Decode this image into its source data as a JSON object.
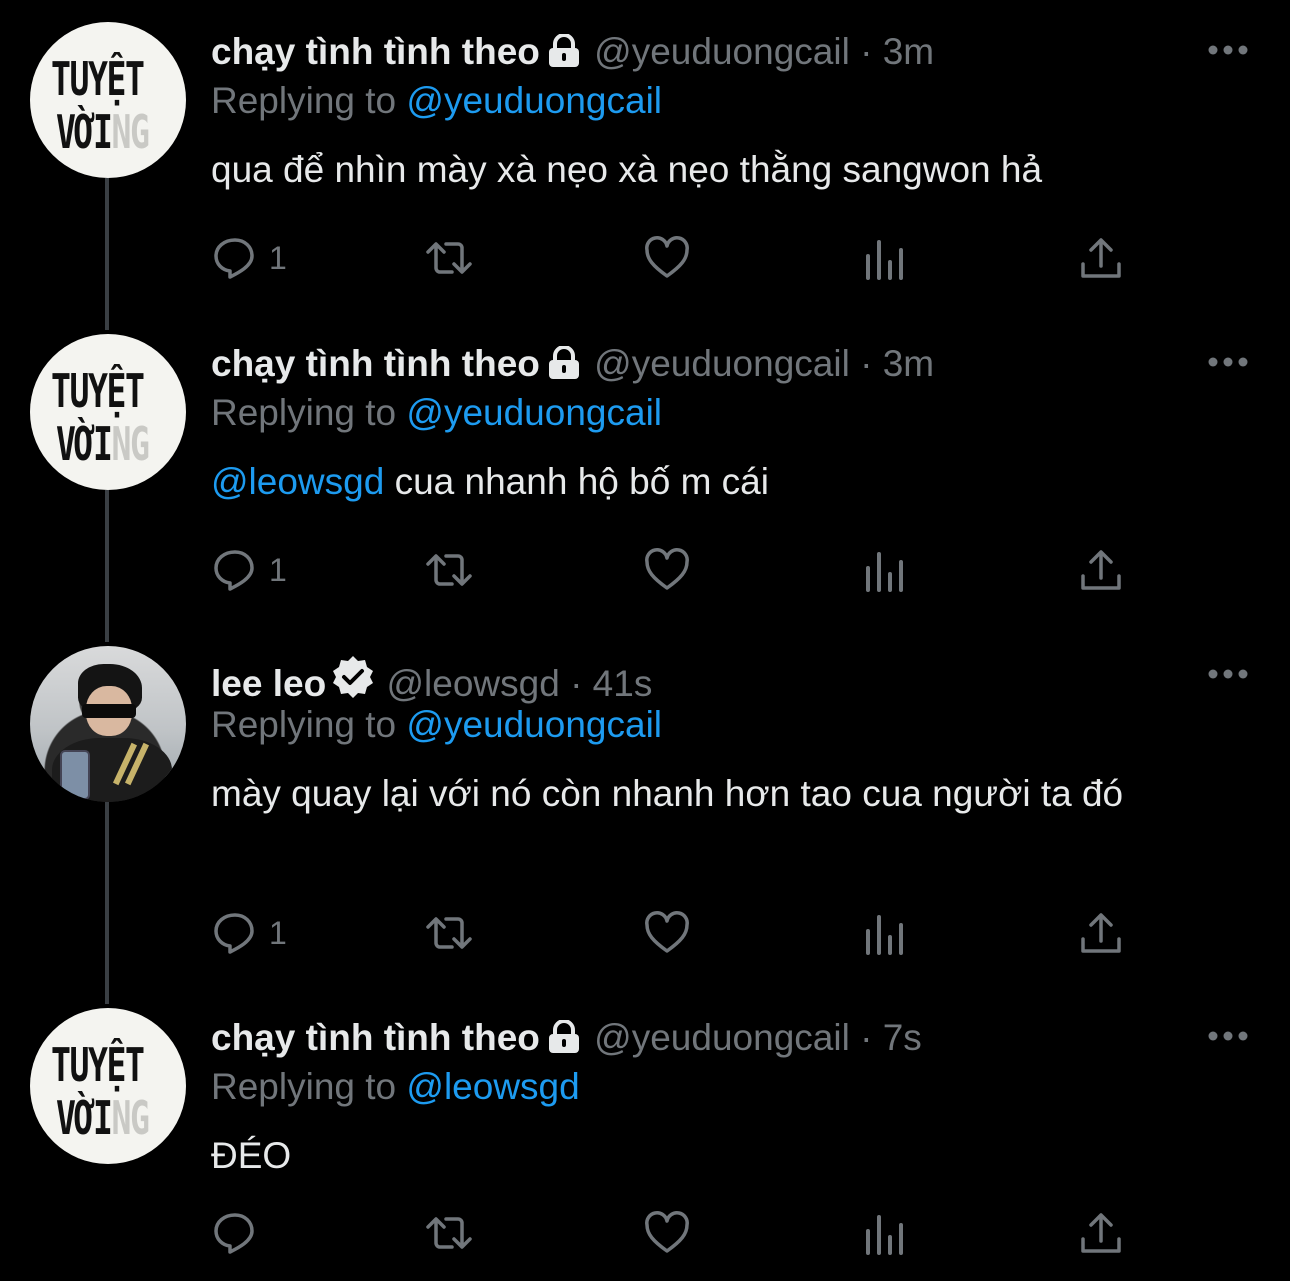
{
  "colors": {
    "background": "#000000",
    "text": "#e7e9ea",
    "muted": "#71767b",
    "link": "#1d9bf0",
    "thread_line": "#3a3f44"
  },
  "tweets": [
    {
      "avatar_logo": [
        "TUYỆT",
        "VỜI",
        "NG"
      ],
      "name": "chạy tình tình theo",
      "badge_icon": "lock-icon",
      "handle": "@yeuduongcail",
      "dot": "·",
      "time": "3m",
      "replying_prefix": "Replying to",
      "replying_to": "@yeuduongcail",
      "mention": "",
      "text": "qua để nhìn mày xà nẹo xà nẹo thằng sangwon hả",
      "reply_count": "1"
    },
    {
      "avatar_logo": [
        "TUYỆT",
        "VỜI",
        "NG"
      ],
      "name": "chạy tình tình theo",
      "badge_icon": "lock-icon",
      "handle": "@yeuduongcail",
      "dot": "·",
      "time": "3m",
      "replying_prefix": "Replying to",
      "replying_to": "@yeuduongcail",
      "mention": "@leowsgd",
      "text": " cua nhanh hộ bố m cái",
      "reply_count": "1"
    },
    {
      "name": "lee leo",
      "badge_icon": "verified-icon",
      "handle": "@leowsgd",
      "dot": "·",
      "time": "41s",
      "replying_prefix": "Replying to",
      "replying_to": "@yeuduongcail",
      "mention": "",
      "text": "mày quay lại với nó còn nhanh hơn tao cua người ta đó",
      "reply_count": "1"
    },
    {
      "avatar_logo": [
        "TUYỆT",
        "VỜI",
        "NG"
      ],
      "name": "chạy tình tình theo",
      "badge_icon": "lock-icon",
      "handle": "@yeuduongcail",
      "dot": "·",
      "time": "7s",
      "replying_prefix": "Replying to",
      "replying_to": "@leowsgd",
      "mention": "",
      "text": "ĐÉO",
      "reply_count": ""
    }
  ]
}
